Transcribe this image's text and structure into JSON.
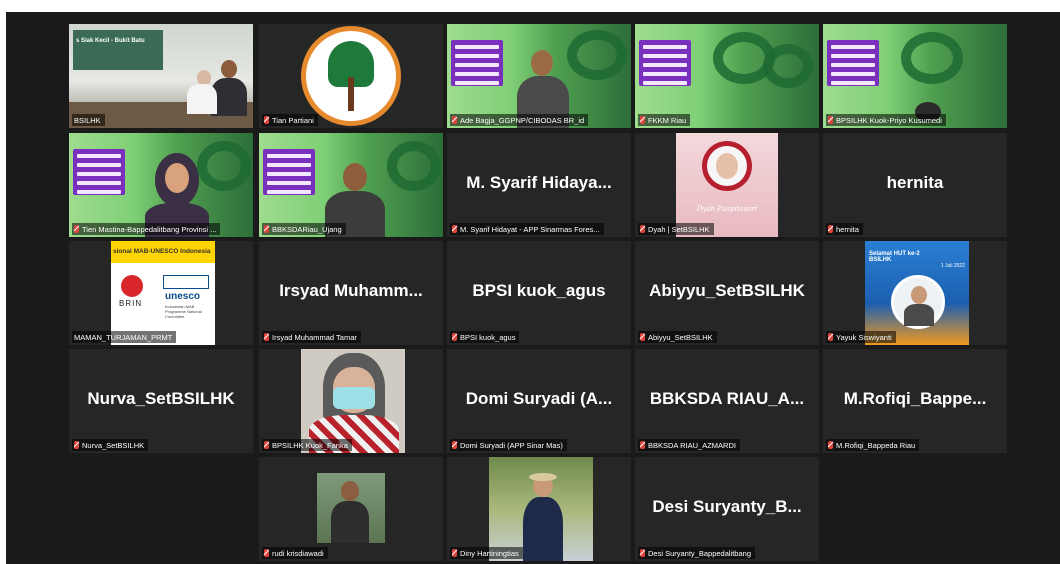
{
  "meeting": {
    "participants": [
      {
        "id": "bsilhk",
        "label": "BSILHK",
        "slide_title": "s Siak Kecil - Bukit Batu",
        "active": true
      },
      {
        "id": "tian",
        "label": "Tian Partiani",
        "muted": true
      },
      {
        "id": "ade",
        "label": "Ade Bagja_GGPNP/CIBODAS BR_id",
        "muted": true
      },
      {
        "id": "fkkm",
        "label": "FKKM Riau",
        "muted": true
      },
      {
        "id": "priyo",
        "label": "BPSILHK Kuok-Priyo Kusumedi",
        "muted": true
      },
      {
        "id": "tien",
        "label": "Tien Mastina-Bappedalitbang Provinsi ...",
        "muted": true
      },
      {
        "id": "ujang",
        "label": "BBKSDARiau_Ujang",
        "muted": true
      },
      {
        "id": "syarif",
        "big_name": "M. Syarif Hidaya...",
        "label": "M. Syarif Hidayat -  APP Sinarmas Fores...",
        "muted": true
      },
      {
        "id": "dyah",
        "label": "Dyah | SetBSILHK",
        "caption": "Dyah Puspitasari",
        "muted": true
      },
      {
        "id": "hernita",
        "big_name": "hernita",
        "label": "hernita",
        "muted": true
      },
      {
        "id": "maman",
        "label": "MAMAN_TURJAMAN_PRMT",
        "slide_title": "sional MAB-UNESCO Indonesia",
        "brin": "BRIN",
        "unesco": "unesco",
        "unesco_sub": "Indonesian MAB Programme National Committee"
      },
      {
        "id": "irsyad",
        "big_name": "Irsyad  Muhamm...",
        "label": "Irsyad Muhammad Tamar",
        "muted": true
      },
      {
        "id": "agus",
        "big_name": "BPSI kuok_agus",
        "label": "BPSI kuok_agus",
        "muted": true
      },
      {
        "id": "abiyyu",
        "big_name": "Abiyyu_SetBSILHK",
        "label": "Abiyyu_SetBSILHK",
        "muted": true
      },
      {
        "id": "yayuk",
        "label": "Yayuk Siswiyanti",
        "poster_title": "Selamat HUT ke-2 BSILHK",
        "poster_date": "1 Juli 2022",
        "muted": true
      },
      {
        "id": "nurva",
        "big_name": "Nurva_SetBSILHK",
        "label": "Nurva_SetBSILHK",
        "muted": true
      },
      {
        "id": "farika",
        "label": "BPSILHK Kuok_Farika",
        "muted": true
      },
      {
        "id": "domi",
        "big_name": "Domi  Suryadi  (A...",
        "label": "Domi Suryadi (APP Sinar Mas)",
        "muted": true
      },
      {
        "id": "azmardi",
        "big_name": "BBKSDA  RIAU_A...",
        "label": "BBKSDA RIAU_AZMARDI",
        "muted": true
      },
      {
        "id": "rofiqi",
        "big_name": "M.Rofiqi_Bappe...",
        "label": "M.Rofiqi_Bappeda Riau",
        "muted": true
      },
      {
        "id": "rudi",
        "label": "rudi krisdiawadi",
        "muted": true
      },
      {
        "id": "diny",
        "label": "Diny Hartiningtias",
        "muted": true
      },
      {
        "id": "desi",
        "big_name": "Desi  Suryanty_B...",
        "label": "Desi Suryanty_Bappedalitbang",
        "muted": true
      }
    ],
    "banner": {
      "tag": "PRE PLANNING",
      "lines": [
        "GIAM SIAK",
        "KECIL",
        "BUKIT BATU",
        "BIOSPHERE",
        "RESERVE"
      ]
    }
  },
  "colors": {
    "stage": "#1a1a1a",
    "tile": "#262626",
    "active_outline": "#e6e64a",
    "muted_mic": "#e0453b",
    "banner_purple": "#7b2fbf"
  }
}
